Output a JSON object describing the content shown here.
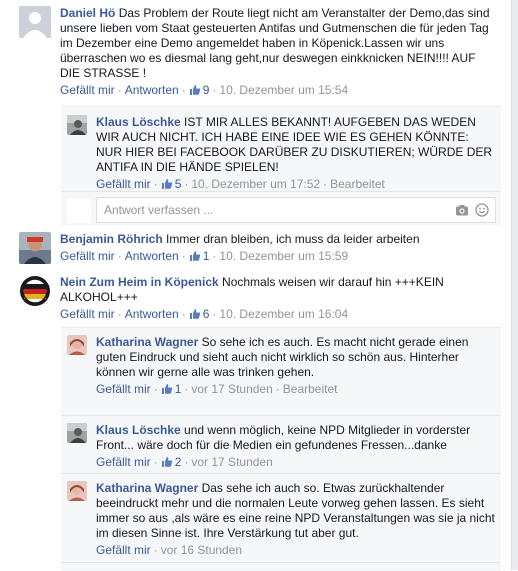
{
  "comments": [
    {
      "name": "Daniel Hö",
      "text": "Das Problem der Route liegt nicht am Veranstalter der Demo,das sind unsere lieben vom Staat gesteuerten Antifas und Gutmenschen die für jeden Tag im Dezember eine Demo angemeldet haben in Köpenick.Lassen wir uns überraschen wo es diesmal lang geht,nur deswegen einkknicken NEIN!!!! AUF DIE STRASSE !",
      "like_label": "Gefällt mir",
      "reply_label": "Antworten",
      "likes": "9",
      "time": "10. Dezember um 15:54",
      "replies": [
        {
          "name": "Klaus Löschke",
          "text": "IST MIR ALLES BEKANNT! AUFGEBEN DAS WEDEN WIR AUCH NICHT. ICH HABE EINE IDEE WIE ES GEHEN KÖNNTE: NUR HIER BEI FACEBOOK DARÜBER ZU DISKUTIEREN; WÜRDE DER ANTIFA IN DIE HÄNDE SPIELEN!",
          "like_label": "Gefällt mir",
          "likes": "5",
          "time": "10. Dezember um 17:52",
          "edited": "Bearbeitet"
        }
      ],
      "reply_placeholder": "Antwort verfassen ..."
    },
    {
      "name": "Benjamin Röhrich",
      "text": "Immer dran bleiben, ich muss da leider arbeiten",
      "like_label": "Gefällt mir",
      "reply_label": "Antworten",
      "likes": "1",
      "time": "10. Dezember um 15:59"
    },
    {
      "name": "Nein Zum Heim in Köpenick",
      "text": "Nochmals weisen wir darauf hin +++KEIN ALKOHOL+++",
      "like_label": "Gefällt mir",
      "reply_label": "Antworten",
      "likes": "6",
      "time": "10. Dezember um 16:04",
      "replies": [
        {
          "name": "Katharina Wagner",
          "text": "So sehe ich es auch. Es macht nicht gerade einen guten Eindruck und sieht auch nicht wirklich so schön aus. Hinterher können wir gerne alle was trinken gehen.",
          "like_label": "Gefällt mir",
          "likes": "1",
          "time": "vor 17 Stunden",
          "edited": "Bearbeitet"
        },
        {
          "name": "Klaus Löschke",
          "text": "und wenn möglich, keine NPD Mitglieder in vorderster Front... wäre doch für die Medien ein gefundenes Fressen...danke",
          "like_label": "Gefällt mir",
          "likes": "2",
          "time": "vor 17 Stunden"
        },
        {
          "name": "Katharina Wagner",
          "text": "Das sehe ich auch so. Etwas zurückhaltender beeindruckt mehr und die normalen Leute vorweg gehen lassen. Es sieht immer so aus ,als wäre es eine reine NPD Veranstaltungen was sie ja nicht im diesen Sinne ist. Ihre Verstärkung tut aber gut.",
          "like_label": "Gefällt mir",
          "time": "vor 16 Stunden"
        }
      ]
    }
  ],
  "icons": {
    "like": "thumbs-up-icon",
    "camera": "camera-icon",
    "emoji": "smiley-icon"
  },
  "colors": {
    "link": "#3b5998",
    "meta": "#90949c",
    "panel": "#f6f7f9"
  }
}
